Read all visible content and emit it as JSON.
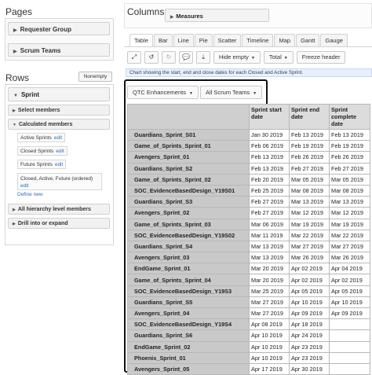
{
  "pages": {
    "title": "Pages",
    "dimensions": [
      "Requester Group",
      "Scrum Teams"
    ]
  },
  "rows": {
    "title": "Rows",
    "nonempty_label": "Nonempty",
    "dimension": "Sprint",
    "sections": {
      "select_members": "Select members",
      "calculated_members": "Calculated members",
      "all_hierarchy": "All hierarchy level members",
      "drill": "Drill into or expand"
    },
    "calculated": [
      {
        "label": "Active Sprints",
        "edit": "edit"
      },
      {
        "label": "Closed Sprints",
        "edit": "edit"
      },
      {
        "label": "Future Sprints",
        "edit": "edit"
      }
    ],
    "calculated_multi": {
      "label": "Closed, Active, Future (ordered)",
      "edit": "edit"
    },
    "define_new": "Define new"
  },
  "columns": {
    "title": "Columns",
    "dimension": "Measures"
  },
  "tabs": [
    {
      "label": "Table",
      "active": true
    },
    {
      "label": "Bar",
      "active": false
    },
    {
      "label": "Line",
      "active": false
    },
    {
      "label": "Pie",
      "active": false
    },
    {
      "label": "Scatter",
      "active": false
    },
    {
      "label": "Timeline",
      "active": false
    },
    {
      "label": "Map",
      "active": false
    },
    {
      "label": "Gantt",
      "active": false
    },
    {
      "label": "Gauge",
      "active": false
    }
  ],
  "toolbar": {
    "icons": [
      "fullscreen-icon",
      "undo-icon",
      "redo-icon",
      "comment-icon",
      "download-icon"
    ],
    "hide_empty": "Hide empty",
    "total": "Total",
    "freeze_header": "Freeze header"
  },
  "info_text": "Chart showing the start, end and close dates for each Closed and Active Sprint.",
  "filters": [
    "QTC Enhancements",
    "All Scrum Teams"
  ],
  "table": {
    "headers": [
      "Sprint start date",
      "Sprint end date",
      "Sprint complete date"
    ],
    "rows": [
      [
        "Guardians_Sprint_S01",
        "Jan 30 2019",
        "Feb 13 2019",
        "Feb 13 2019"
      ],
      [
        "Game_of_Sprints_Sprint_01",
        "Feb 06 2019",
        "Feb 19 2019",
        "Feb 19 2019"
      ],
      [
        "Avengers_Sprint_01",
        "Feb 13 2019",
        "Feb 26 2019",
        "Feb 26 2019"
      ],
      [
        "Guardians_Sprint_S2",
        "Feb 13 2019",
        "Feb 27 2019",
        "Feb 27 2019"
      ],
      [
        "Game_of_Sprints_Sprint_02",
        "Feb 20 2019",
        "Mar 05 2019",
        "Mar 05 2019"
      ],
      [
        "SOC_EvidenceBasedDesign_Y19S01",
        "Feb 25 2019",
        "Mar 08 2019",
        "Mar 08 2019"
      ],
      [
        "Guardians_Sprint_S3",
        "Feb 27 2019",
        "Mar 13 2019",
        "Mar 13 2019"
      ],
      [
        "Avengers_Sprint_02",
        "Feb 27 2019",
        "Mar 12 2019",
        "Mar 12 2019"
      ],
      [
        "Game_of_Sprints_Sprint_03",
        "Mar 06 2019",
        "Mar 19 2019",
        "Mar 19 2019"
      ],
      [
        "SOC_EvidenceBasedDesign_Y19S02",
        "Mar 11 2019",
        "Mar 22 2019",
        "Mar 22 2019"
      ],
      [
        "Guardians_Sprint_S4",
        "Mar 13 2019",
        "Mar 27 2019",
        "Mar 27 2019"
      ],
      [
        "Avengers_Sprint_03",
        "Mar 13 2019",
        "Mar 26 2019",
        "Mar 26 2019"
      ],
      [
        "EndGame_Sprint_01",
        "Mar 20 2019",
        "Apr 02 2019",
        "Apr 04 2019"
      ],
      [
        "Game_of_Sprints_Sprint_04",
        "Mar 20 2019",
        "Apr 02 2019",
        "Apr 02 2019"
      ],
      [
        "SOC_EvidenceBasedDesign_Y19S3",
        "Mar 25 2019",
        "Apr 05 2019",
        "Apr 05 2019"
      ],
      [
        "Guardians_Sprint_S5",
        "Mar 27 2019",
        "Apr 10 2019",
        "Apr 10 2019"
      ],
      [
        "Avengers_Sprint_04",
        "Mar 27 2019",
        "Apr 09 2019",
        "Apr 09 2019"
      ],
      [
        "SOC_EvidenceBasedDesign_Y19S4",
        "Apr 08 2019",
        "Apr 18 2019",
        ""
      ],
      [
        "Guardians_Sprint_S6",
        "Apr 10 2019",
        "Apr 24 2019",
        ""
      ],
      [
        "EndGame_Sprint_02",
        "Apr 10 2019",
        "Apr 23 2019",
        ""
      ],
      [
        "Phoenix_Sprint_01",
        "Apr 10 2019",
        "Apr 23 2019",
        ""
      ],
      [
        "Avengers_Sprint_05",
        "Apr 17 2019",
        "Apr 30 2019",
        ""
      ]
    ]
  }
}
